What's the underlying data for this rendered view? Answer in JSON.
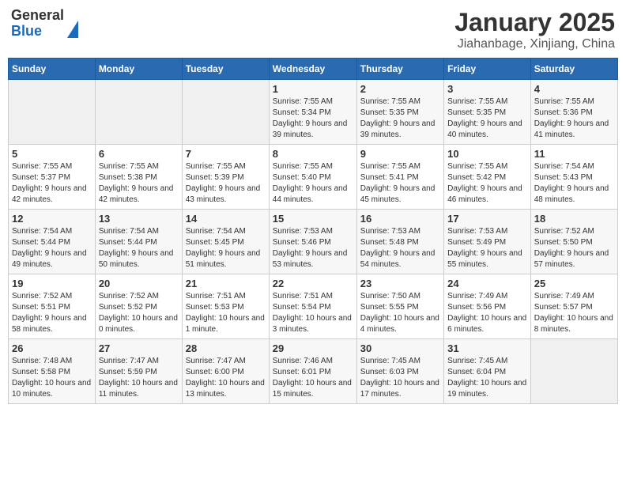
{
  "header": {
    "logo": {
      "general": "General",
      "blue": "Blue"
    },
    "title": "January 2025",
    "location": "Jiahanbage, Xinjiang, China"
  },
  "weekdays": [
    "Sunday",
    "Monday",
    "Tuesday",
    "Wednesday",
    "Thursday",
    "Friday",
    "Saturday"
  ],
  "weeks": [
    [
      {
        "day": "",
        "empty": true
      },
      {
        "day": "",
        "empty": true
      },
      {
        "day": "",
        "empty": true
      },
      {
        "day": "1",
        "sunrise": "7:55 AM",
        "sunset": "5:34 PM",
        "daylight": "9 hours and 39 minutes."
      },
      {
        "day": "2",
        "sunrise": "7:55 AM",
        "sunset": "5:35 PM",
        "daylight": "9 hours and 39 minutes."
      },
      {
        "day": "3",
        "sunrise": "7:55 AM",
        "sunset": "5:35 PM",
        "daylight": "9 hours and 40 minutes."
      },
      {
        "day": "4",
        "sunrise": "7:55 AM",
        "sunset": "5:36 PM",
        "daylight": "9 hours and 41 minutes."
      }
    ],
    [
      {
        "day": "5",
        "sunrise": "7:55 AM",
        "sunset": "5:37 PM",
        "daylight": "9 hours and 42 minutes."
      },
      {
        "day": "6",
        "sunrise": "7:55 AM",
        "sunset": "5:38 PM",
        "daylight": "9 hours and 42 minutes."
      },
      {
        "day": "7",
        "sunrise": "7:55 AM",
        "sunset": "5:39 PM",
        "daylight": "9 hours and 43 minutes."
      },
      {
        "day": "8",
        "sunrise": "7:55 AM",
        "sunset": "5:40 PM",
        "daylight": "9 hours and 44 minutes."
      },
      {
        "day": "9",
        "sunrise": "7:55 AM",
        "sunset": "5:41 PM",
        "daylight": "9 hours and 45 minutes."
      },
      {
        "day": "10",
        "sunrise": "7:55 AM",
        "sunset": "5:42 PM",
        "daylight": "9 hours and 46 minutes."
      },
      {
        "day": "11",
        "sunrise": "7:54 AM",
        "sunset": "5:43 PM",
        "daylight": "9 hours and 48 minutes."
      }
    ],
    [
      {
        "day": "12",
        "sunrise": "7:54 AM",
        "sunset": "5:44 PM",
        "daylight": "9 hours and 49 minutes."
      },
      {
        "day": "13",
        "sunrise": "7:54 AM",
        "sunset": "5:44 PM",
        "daylight": "9 hours and 50 minutes."
      },
      {
        "day": "14",
        "sunrise": "7:54 AM",
        "sunset": "5:45 PM",
        "daylight": "9 hours and 51 minutes."
      },
      {
        "day": "15",
        "sunrise": "7:53 AM",
        "sunset": "5:46 PM",
        "daylight": "9 hours and 53 minutes."
      },
      {
        "day": "16",
        "sunrise": "7:53 AM",
        "sunset": "5:48 PM",
        "daylight": "9 hours and 54 minutes."
      },
      {
        "day": "17",
        "sunrise": "7:53 AM",
        "sunset": "5:49 PM",
        "daylight": "9 hours and 55 minutes."
      },
      {
        "day": "18",
        "sunrise": "7:52 AM",
        "sunset": "5:50 PM",
        "daylight": "9 hours and 57 minutes."
      }
    ],
    [
      {
        "day": "19",
        "sunrise": "7:52 AM",
        "sunset": "5:51 PM",
        "daylight": "9 hours and 58 minutes."
      },
      {
        "day": "20",
        "sunrise": "7:52 AM",
        "sunset": "5:52 PM",
        "daylight": "10 hours and 0 minutes."
      },
      {
        "day": "21",
        "sunrise": "7:51 AM",
        "sunset": "5:53 PM",
        "daylight": "10 hours and 1 minute."
      },
      {
        "day": "22",
        "sunrise": "7:51 AM",
        "sunset": "5:54 PM",
        "daylight": "10 hours and 3 minutes."
      },
      {
        "day": "23",
        "sunrise": "7:50 AM",
        "sunset": "5:55 PM",
        "daylight": "10 hours and 4 minutes."
      },
      {
        "day": "24",
        "sunrise": "7:49 AM",
        "sunset": "5:56 PM",
        "daylight": "10 hours and 6 minutes."
      },
      {
        "day": "25",
        "sunrise": "7:49 AM",
        "sunset": "5:57 PM",
        "daylight": "10 hours and 8 minutes."
      }
    ],
    [
      {
        "day": "26",
        "sunrise": "7:48 AM",
        "sunset": "5:58 PM",
        "daylight": "10 hours and 10 minutes."
      },
      {
        "day": "27",
        "sunrise": "7:47 AM",
        "sunset": "5:59 PM",
        "daylight": "10 hours and 11 minutes."
      },
      {
        "day": "28",
        "sunrise": "7:47 AM",
        "sunset": "6:00 PM",
        "daylight": "10 hours and 13 minutes."
      },
      {
        "day": "29",
        "sunrise": "7:46 AM",
        "sunset": "6:01 PM",
        "daylight": "10 hours and 15 minutes."
      },
      {
        "day": "30",
        "sunrise": "7:45 AM",
        "sunset": "6:03 PM",
        "daylight": "10 hours and 17 minutes."
      },
      {
        "day": "31",
        "sunrise": "7:45 AM",
        "sunset": "6:04 PM",
        "daylight": "10 hours and 19 minutes."
      },
      {
        "day": "",
        "empty": true
      }
    ]
  ],
  "labels": {
    "sunrise": "Sunrise:",
    "sunset": "Sunset:",
    "daylight": "Daylight:"
  }
}
